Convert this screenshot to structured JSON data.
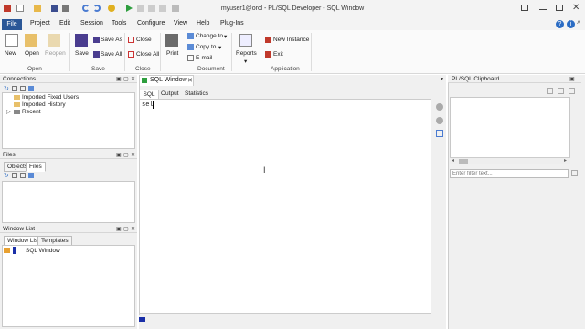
{
  "title": "myuser1@orcl - PL/SQL Developer - SQL Window",
  "menu": {
    "file": "File",
    "items": [
      "Project",
      "Edit",
      "Session",
      "Tools",
      "Configure",
      "View",
      "Help",
      "Plug-Ins"
    ]
  },
  "ribbon": {
    "new": "New",
    "open": "Open",
    "reopen": "Reopen",
    "save": "Save",
    "save_as": "Save As",
    "save_all": "Save All",
    "close": "Close",
    "close_all": "Close All",
    "print": "Print",
    "change_to": "Change to",
    "copy_to": "Copy to",
    "email": "E-mail",
    "reports": "Reports",
    "new_instance": "New Instance",
    "exit": "Exit",
    "groups": {
      "open": "Open",
      "save": "Save",
      "close": "Close",
      "document": "Document",
      "application": "Application"
    }
  },
  "connections": {
    "title": "Connections",
    "items": [
      "Imported Fixed Users",
      "Imported History",
      "Recent"
    ]
  },
  "files": {
    "title": "Files",
    "tabs": [
      "Objects",
      "Files"
    ]
  },
  "window_list": {
    "title": "Window List",
    "tabs": [
      "Window List",
      "Templates"
    ],
    "items": [
      "SQL Window"
    ]
  },
  "editor": {
    "doc_tab": "SQL Window",
    "tabs": [
      "SQL",
      "Output",
      "Statistics"
    ],
    "text": "sel"
  },
  "clipboard": {
    "title": "PL/SQL Clipboard",
    "filter_placeholder": "Enter filter text..."
  },
  "colors": {
    "file_tab": "#2b5797",
    "panel_header": "#f0f0f0",
    "border": "#c8c8c8"
  }
}
